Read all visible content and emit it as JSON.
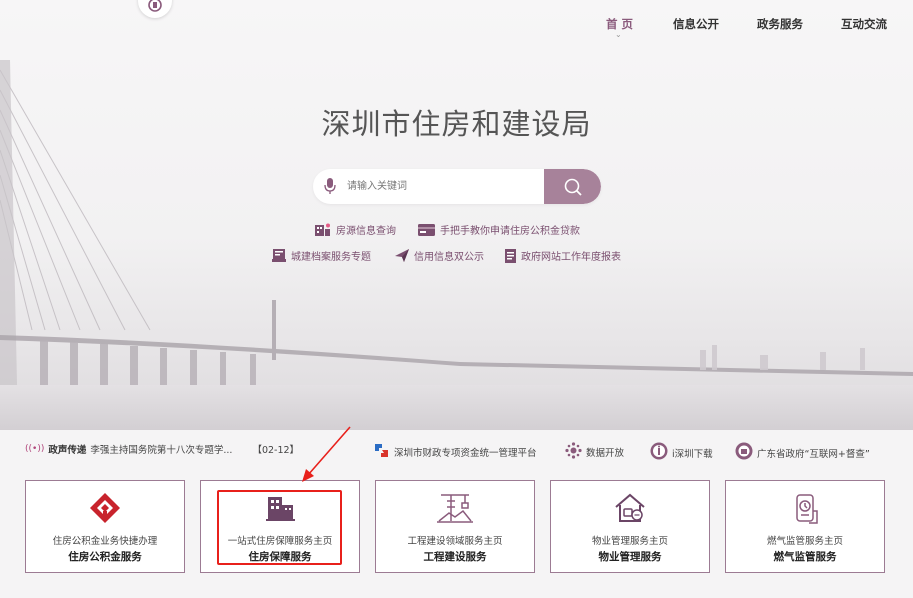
{
  "nav": {
    "items": [
      {
        "label": "首 页",
        "active": true
      },
      {
        "label": "信息公开",
        "active": false
      },
      {
        "label": "政务服务",
        "active": false
      },
      {
        "label": "互动交流",
        "active": false
      }
    ],
    "active_marker": "⌄"
  },
  "header": {
    "title": "深圳市住房和建设局"
  },
  "search": {
    "placeholder": "请输入关键词"
  },
  "quick_links": [
    {
      "label": "房源信息查询",
      "icon": "building-icon"
    },
    {
      "label": "手把手教你申请住房公积金贷款",
      "icon": "card-icon"
    },
    {
      "label": "城建档案服务专题",
      "icon": "archive-icon"
    },
    {
      "label": "信用信息双公示",
      "icon": "send-icon"
    },
    {
      "label": "政府网站工作年度报表",
      "icon": "report-icon"
    }
  ],
  "news": {
    "tag_icon": "((•))",
    "tag": "政声传递",
    "headline": "李强主持国务院第十八次专题学...",
    "date": "【02-12】",
    "links": [
      {
        "label": "深圳市财政专项资金统一管理平台",
        "icon": "finance-platform-icon"
      },
      {
        "label": "数据开放",
        "icon": "data-open-icon"
      },
      {
        "label": "i深圳下载",
        "icon": "i-shenzhen-icon"
      },
      {
        "label": "广东省政府“互联网+督查”",
        "icon": "gd-gov-icon"
      }
    ]
  },
  "services": [
    {
      "subtitle": "住房公积金业务快捷办理",
      "title": "住房公积金服务",
      "icon": "provident-fund-icon"
    },
    {
      "subtitle": "一站式住房保障服务主页",
      "title": "住房保障服务",
      "icon": "housing-security-icon"
    },
    {
      "subtitle": "工程建设领域服务主页",
      "title": "工程建设服务",
      "icon": "construction-icon"
    },
    {
      "subtitle": "物业管理服务主页",
      "title": "物业管理服务",
      "icon": "property-icon"
    },
    {
      "subtitle": "燃气监管服务主页",
      "title": "燃气监管服务",
      "icon": "gas-icon"
    }
  ],
  "colors": {
    "accent": "#8a5b7c",
    "search_button": "#a7829a",
    "highlight": "#e8201b",
    "card_border": "#9c7b93"
  }
}
